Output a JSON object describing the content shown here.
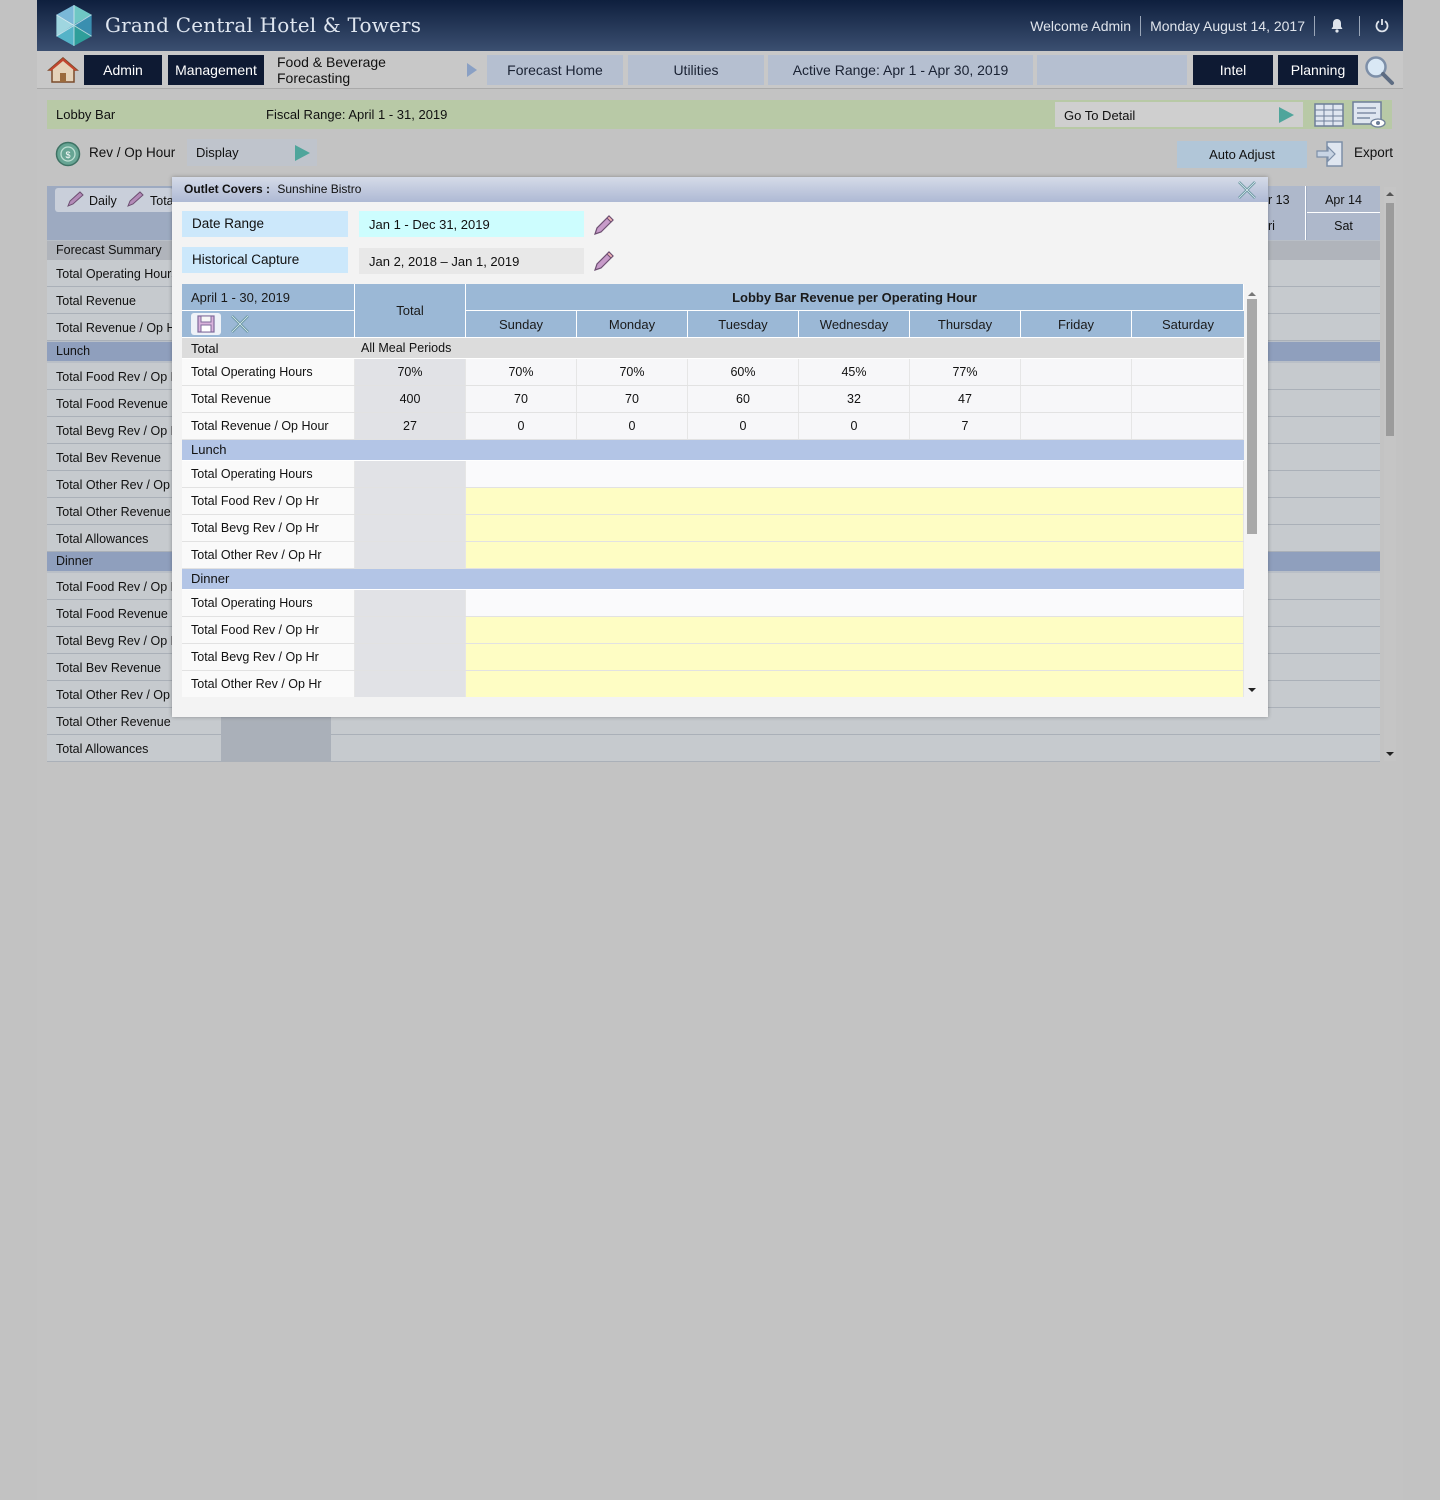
{
  "header": {
    "brand": "Grand Central Hotel & Towers",
    "welcome": "Welcome Admin",
    "date": "Monday August 14, 2017"
  },
  "nav": {
    "admin": "Admin",
    "management": "Management",
    "module": "Food & Beverage Forecasting",
    "forecast_home": "Forecast Home",
    "utilities": "Utilities",
    "active_range": "Active Range: Apr 1 -  Apr 30, 2019",
    "intel": "Intel",
    "planning": "Planning"
  },
  "toolbar": {
    "outlet": "Lobby Bar",
    "fiscal_range": "Fiscal Range: April 1 - 31, 2019",
    "go_to_detail": "Go To Detail",
    "rev_op_hour": "Rev / Op Hour",
    "display": "Display",
    "auto_adjust": "Auto Adjust",
    "export": "Export"
  },
  "background_grid": {
    "tabs": [
      "Daily",
      "Tota"
    ],
    "col_headers": [
      {
        "date": "r 13",
        "day": "ri"
      },
      {
        "date": "Apr 14",
        "day": "Sat"
      }
    ],
    "sections": [
      {
        "title": "Forecast Summary",
        "rows": [
          "Total Operating Hours",
          "Total Revenue",
          "Total Revenue / Op Ho"
        ]
      },
      {
        "title": "Lunch",
        "rows": [
          "Total Food Rev / Op H",
          "Total Food Revenue",
          "Total Bevg Rev / Op H",
          "Total Bev Revenue",
          "Total Other Rev / Op H",
          "Total Other Revenue",
          "Total Allowances"
        ]
      },
      {
        "title": "Dinner",
        "rows": [
          "Total Food Rev / Op H",
          "Total Food Revenue",
          "Total Bevg Rev / Op H",
          "Total Bev Revenue",
          "Total Other Rev / Op H",
          "Total Other Revenue",
          "Total Allowances"
        ]
      }
    ]
  },
  "modal": {
    "title_label": "Outlet Covers :",
    "title_value": "Sunshine Bistro",
    "date_range_label": "Date Range",
    "date_range_value": "Jan 1 - Dec 31, 2019",
    "historical_label": "Historical Capture",
    "historical_value": "Jan 2, 2018 – Jan 1, 2019",
    "table": {
      "period": "April 1 - 30, 2019",
      "total_header": "Total",
      "group_header": "Lobby Bar Revenue per Operating Hour",
      "days": [
        "Sunday",
        "Monday",
        "Tuesday",
        "Wednesday",
        "Thursday",
        "Friday",
        "Saturday"
      ],
      "total_section": {
        "label": "Total",
        "sublabel": "All Meal Periods"
      },
      "total_rows": [
        {
          "label": "Total Operating Hours",
          "total": "70%",
          "values": [
            "70%",
            "70%",
            "60%",
            "45%",
            "77%",
            "",
            ""
          ]
        },
        {
          "label": "Total Revenue",
          "total": "400",
          "values": [
            "70",
            "70",
            "60",
            "32",
            "47",
            "",
            ""
          ]
        },
        {
          "label": "Total Revenue / Op Hour",
          "total": "27",
          "values": [
            "0",
            "0",
            "0",
            "0",
            "7",
            "",
            ""
          ]
        }
      ],
      "lunch_section": "Lunch",
      "lunch_rows": [
        "Total Operating Hours",
        "Total Food Rev / Op Hr",
        "Total Bevg Rev / Op Hr",
        "Total Other Rev / Op Hr"
      ],
      "dinner_section": "Dinner",
      "dinner_rows": [
        "Total Operating Hours",
        "Total Food Rev / Op Hr",
        "Total Bevg Rev / Op Hr",
        "Total Other Rev / Op Hr"
      ]
    }
  },
  "colors": {
    "header_dark": "#0e1a33",
    "nav_light": "#b5bfd0",
    "table_header": "#9bb8d6",
    "section_bar": "#b3c5e6",
    "editable_cell": "#fefdc4",
    "field_label": "#cce8fb"
  }
}
